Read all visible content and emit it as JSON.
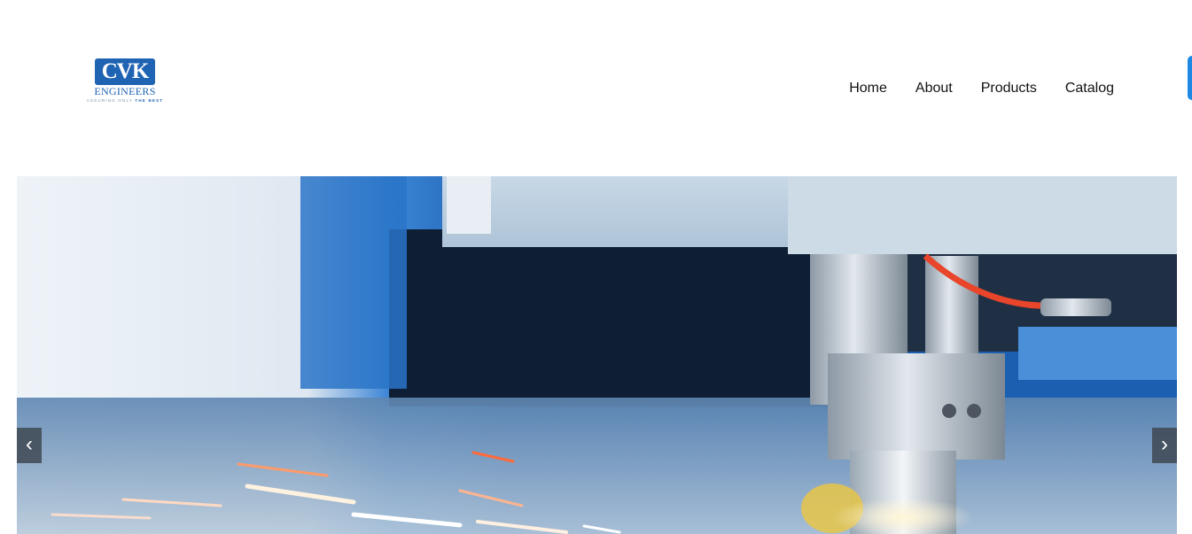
{
  "logo": {
    "mark": "CVK",
    "name": "ENGINEERS",
    "tagline_prefix": "ASSURING ONLY ",
    "tagline_emphasis": "THE BEST"
  },
  "nav": {
    "items": [
      "Home",
      "About",
      "Products",
      "Catalog"
    ]
  },
  "hero": {
    "prev_label": "‹",
    "next_label": "›"
  },
  "colors": {
    "brand_blue": "#1f63b3",
    "accent_blue": "#1e88e5"
  }
}
